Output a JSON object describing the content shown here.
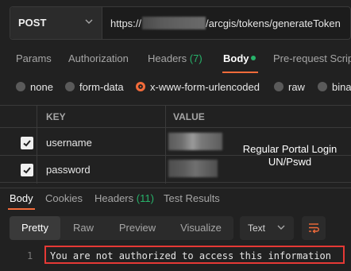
{
  "request": {
    "method": "POST",
    "url_prefix": "https://",
    "url_suffix": "/arcgis/tokens/generateToken"
  },
  "request_tabs": [
    {
      "label": "Params"
    },
    {
      "label": "Authorization"
    },
    {
      "label": "Headers",
      "count": "(7)"
    },
    {
      "label": "Body"
    },
    {
      "label": "Pre-request Scrip"
    }
  ],
  "body_types": [
    {
      "label": "none",
      "selected": false
    },
    {
      "label": "form-data",
      "selected": false
    },
    {
      "label": "x-www-form-urlencoded",
      "selected": true
    },
    {
      "label": "raw",
      "selected": false
    },
    {
      "label": "bina",
      "selected": false
    }
  ],
  "table": {
    "key_header": "KEY",
    "value_header": "VALUE",
    "rows": [
      {
        "key": "username",
        "checked": true
      },
      {
        "key": "password",
        "checked": true
      }
    ]
  },
  "annotation": {
    "line1": "Regular Portal Login",
    "line2": "UN/Pswd"
  },
  "response_tabs": [
    {
      "label": "Body"
    },
    {
      "label": "Cookies"
    },
    {
      "label": "Headers",
      "count": "(11)"
    },
    {
      "label": "Test Results"
    }
  ],
  "view_modes": [
    "Pretty",
    "Raw",
    "Preview",
    "Visualize"
  ],
  "format": "Text",
  "response": {
    "line_number": "1",
    "text": "You are not authorized to access this information"
  },
  "colors": {
    "accent": "#f26b3a",
    "green": "#27b36a",
    "highlight_border": "#e53935"
  }
}
